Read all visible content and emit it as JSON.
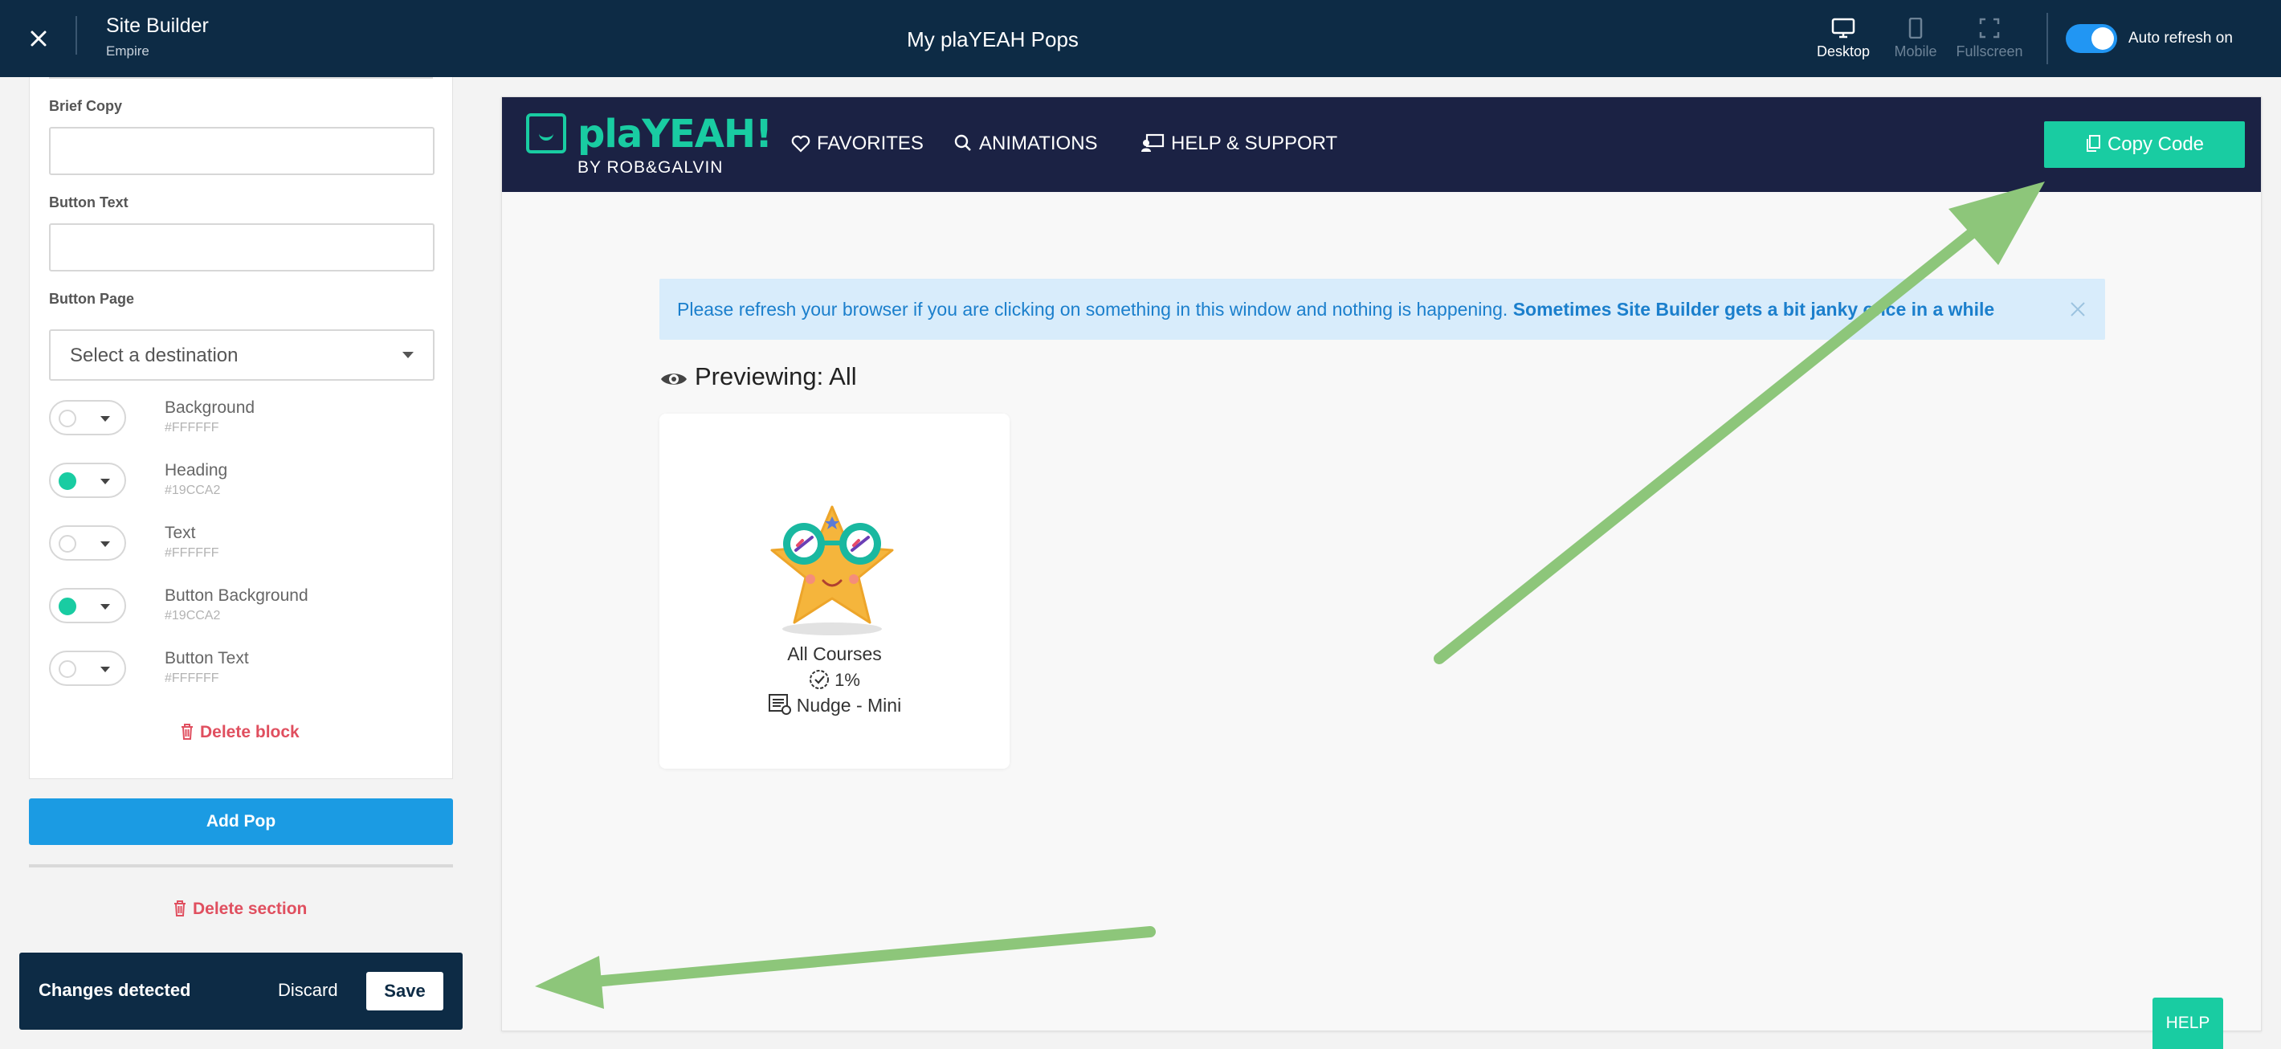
{
  "topbar": {
    "app_title": "Site Builder",
    "app_subtitle": "Empire",
    "page_title": "My plaYEAH Pops",
    "views": [
      {
        "label": "Desktop",
        "icon": "desktop-icon",
        "active": true
      },
      {
        "label": "Mobile",
        "icon": "mobile-icon",
        "active": false
      },
      {
        "label": "Fullscreen",
        "icon": "fullscreen-icon",
        "active": false
      }
    ],
    "auto_refresh_label": "Auto refresh on",
    "auto_refresh_on": true
  },
  "editor": {
    "brief_copy_label": "Brief Copy",
    "brief_copy_value": "",
    "button_text_label": "Button Text",
    "button_text_value": "",
    "button_page_label": "Button Page",
    "button_page_value": "Select a destination",
    "colors": [
      {
        "name": "Background",
        "hex": "#FFFFFF"
      },
      {
        "name": "Heading",
        "hex": "#19CCA2"
      },
      {
        "name": "Text",
        "hex": "#FFFFFF"
      },
      {
        "name": "Button Background",
        "hex": "#19CCA2"
      },
      {
        "name": "Button Text",
        "hex": "#FFFFFF"
      }
    ],
    "delete_block": "Delete block",
    "add_pop": "Add Pop",
    "delete_section": "Delete section"
  },
  "changes": {
    "message": "Changes detected",
    "discard": "Discard",
    "save": "Save"
  },
  "preview": {
    "logo_text": "plaYEAH!",
    "logo_sub": "BY ROB&GALVIN",
    "nav": [
      "FAVORITES",
      "ANIMATIONS",
      "HELP & SUPPORT"
    ],
    "copy_code": "Copy Code",
    "alert_text": "Please refresh your browser if you are clicking on something in this window and nothing is happening.",
    "alert_bold": "Sometimes Site Builder gets a bit janky once in a while",
    "previewing": "Previewing: All",
    "card": {
      "title": "All Courses",
      "progress": "1%",
      "type": "Nudge - Mini"
    },
    "help": "HELP"
  },
  "colors": {
    "topbar_bg": "#0d2b45",
    "accent_teal": "#19cca2",
    "primary_blue": "#1b9be3",
    "danger": "#e04f5f",
    "site_nav_bg": "#1b2244",
    "annotation_arrow": "#8dc67a"
  }
}
